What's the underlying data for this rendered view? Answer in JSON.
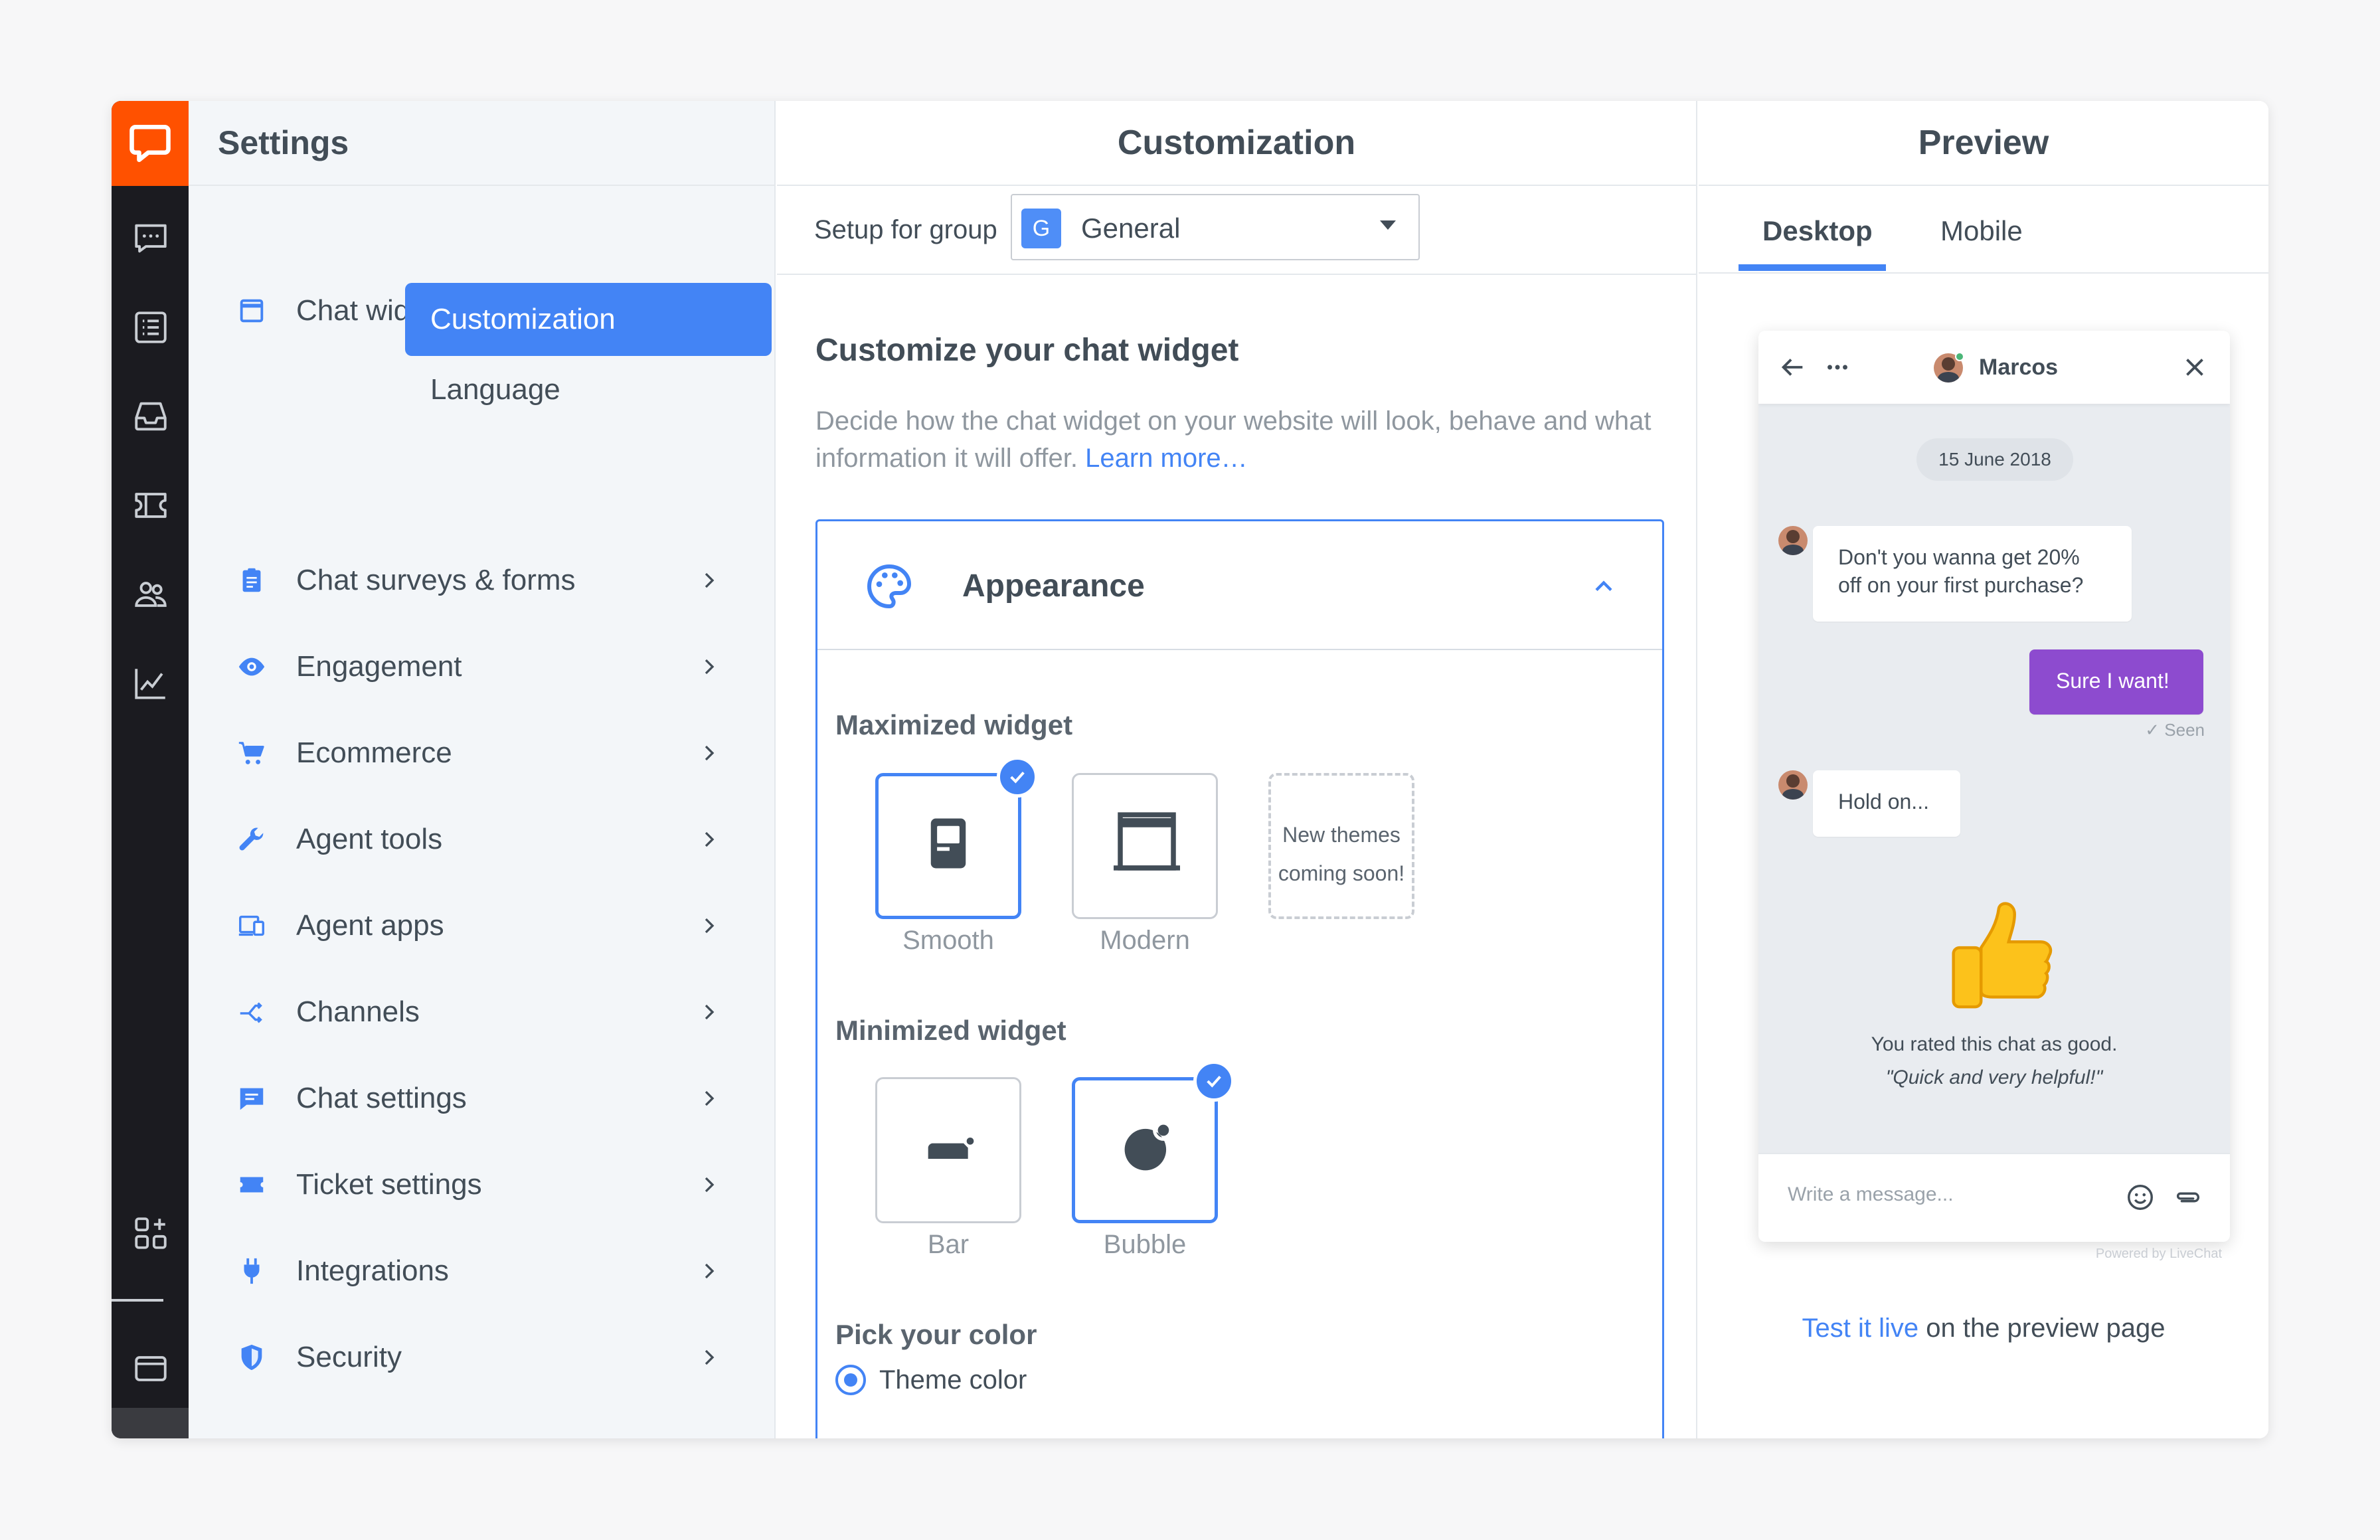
{
  "settings": {
    "title": "Settings"
  },
  "nav": {
    "chat_widget": "Chat widget",
    "sub_customization": "Customization",
    "sub_language": "Language",
    "items": [
      {
        "label": "Chat surveys & forms"
      },
      {
        "label": "Engagement"
      },
      {
        "label": "Ecommerce"
      },
      {
        "label": "Agent tools"
      },
      {
        "label": "Agent apps"
      },
      {
        "label": "Channels"
      },
      {
        "label": "Chat settings"
      },
      {
        "label": "Ticket settings"
      },
      {
        "label": "Integrations"
      },
      {
        "label": "Security"
      }
    ]
  },
  "customization": {
    "title": "Customization",
    "group_label": "Setup for group",
    "group_badge": "G",
    "group_value": "General",
    "heading": "Customize your chat widget",
    "description": "Decide how the chat widget on your website will look, behave and what information it will offer.",
    "learn_more": "Learn more…",
    "appearance": "Appearance",
    "maximized_label": "Maximized widget",
    "max_options": [
      "Smooth",
      "Modern"
    ],
    "new_themes_line1": "New themes",
    "new_themes_line2": "coming soon!",
    "minimized_label": "Minimized widget",
    "min_options": [
      "Bar",
      "Bubble"
    ],
    "pick_color": "Pick your color",
    "theme_color": "Theme color",
    "colors": {
      "accent": "#4384f5",
      "brand": "#ff5100",
      "agent_bubble": "#8d4bcf"
    }
  },
  "preview": {
    "title": "Preview",
    "tab_desktop": "Desktop",
    "tab_mobile": "Mobile",
    "agent_name": "Marcos",
    "date": "15 June 2018",
    "msg1": "Don't you wanna get 20% off on your first purchase?",
    "msg2": "Sure I want!",
    "seen": "Seen",
    "msg3": "Hold on...",
    "rated": "You rated this chat as good.",
    "quote": "\"Quick and very helpful!\"",
    "input_placeholder": "Write a message...",
    "powered": "Powered by LiveChat",
    "test_live": "Test it live",
    "test_live_rest": " on the preview page"
  }
}
